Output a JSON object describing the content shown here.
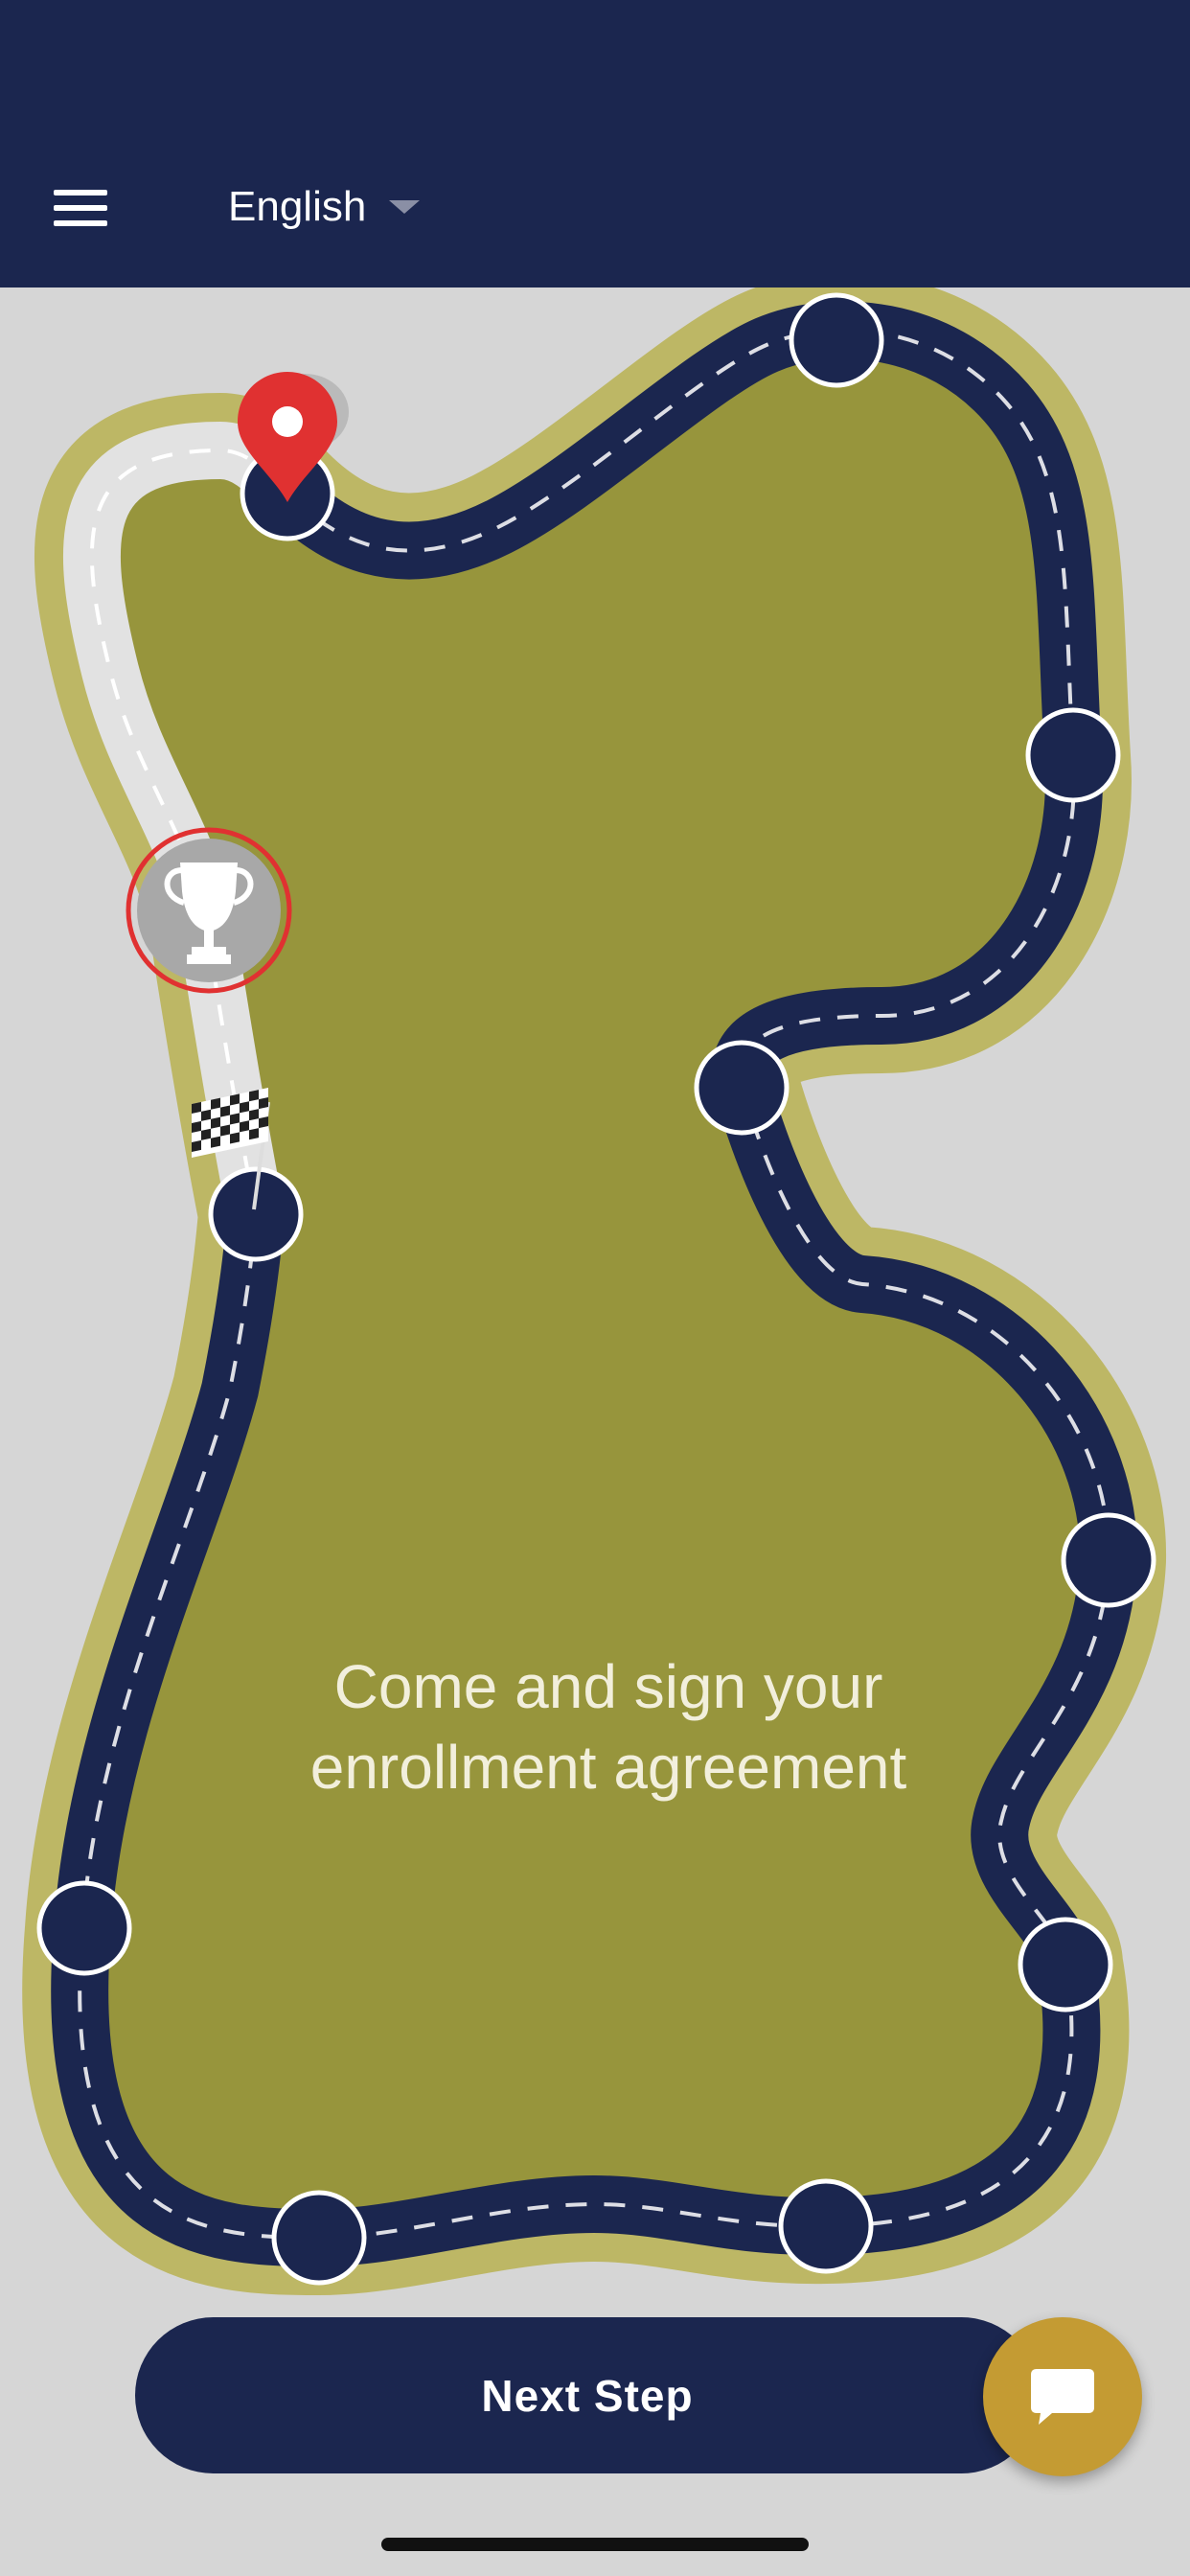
{
  "header": {
    "menu_icon": "hamburger-menu-icon",
    "language": "English"
  },
  "track": {
    "message_line1": "Come and sign your",
    "message_line2": "enrollment agreement",
    "current_marker_icon": "location-pin-icon",
    "goal_icon": "trophy-icon",
    "start_icon": "checkered-flag-icon",
    "colors": {
      "road": "#1b264f",
      "road_completed": "#e2e2e2",
      "field": "#97953c",
      "border": "#bdb765",
      "pin": "#e03131",
      "goal_ring": "#e03131"
    }
  },
  "actions": {
    "next_step_label": "Next Step",
    "chat_icon": "chat-bubble-icon"
  }
}
